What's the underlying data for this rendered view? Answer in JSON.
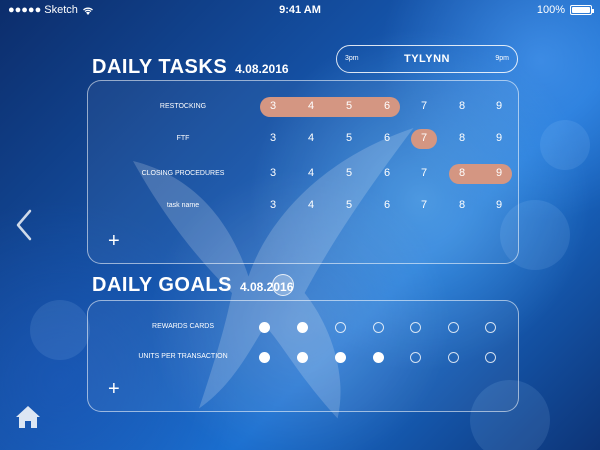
{
  "status_bar": {
    "carrier": "●●●●● Sketch",
    "time": "9:41 AM",
    "battery": "100%"
  },
  "shift": {
    "start": "3pm",
    "name": "TYLYNN",
    "end": "9pm"
  },
  "tasks": {
    "title": "DAILY TASKS",
    "date": "4.08.2016",
    "hours": [
      "3",
      "4",
      "5",
      "6",
      "7",
      "8",
      "9"
    ],
    "rows": [
      {
        "label": "RESTOCKING",
        "highlight": [
          0,
          3
        ]
      },
      {
        "label": "FTF",
        "highlight": [
          4,
          4
        ]
      },
      {
        "label": "CLOSING PROCEDURES",
        "highlight": [
          5,
          6
        ]
      },
      {
        "label": "task name",
        "highlight": null
      }
    ],
    "add_label": "+"
  },
  "goals": {
    "title": "DAILY GOALS",
    "date": "4.08.2016",
    "rows": [
      {
        "label": "REWARDS CARDS",
        "dots": [
          true,
          true,
          false,
          false,
          false,
          false,
          false
        ]
      },
      {
        "label": "UNITS PER TRANSACTION",
        "dots": [
          true,
          true,
          true,
          true,
          false,
          false,
          false
        ]
      }
    ],
    "add_label": "+"
  },
  "colors": {
    "highlight": "#d49682",
    "background": "#1658b0"
  },
  "icons": {
    "back": "chevron-left-icon",
    "home": "home-icon",
    "wifi": "wifi-icon",
    "battery": "battery-icon"
  }
}
